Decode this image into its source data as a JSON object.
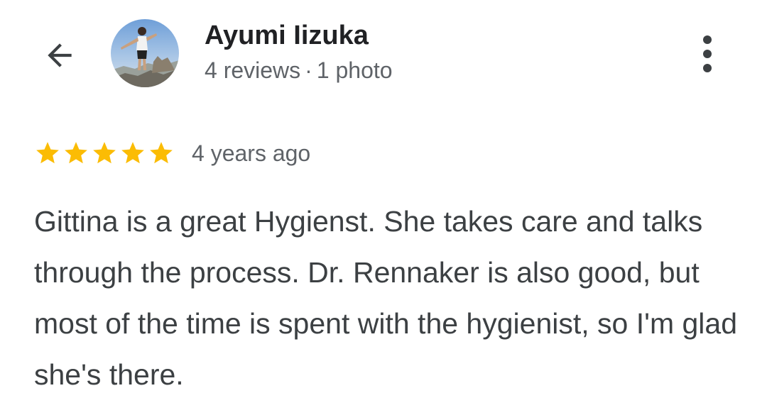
{
  "header": {
    "back_icon": "arrow-left-icon",
    "reviewer_name": "Ayumi Iizuka",
    "reviews_count": "4 reviews",
    "separator": "·",
    "photos_count": "1 photo",
    "more_icon": "more-vert-icon"
  },
  "review": {
    "rating": 5,
    "max_rating": 5,
    "star_color": "#fbbc04",
    "date": "4 years ago",
    "text": "Gittina is a great Hygienst. She takes care and talks through the process. Dr. Rennaker is also good, but most of the time is spent with the hygienist, so I'm glad she's there."
  }
}
